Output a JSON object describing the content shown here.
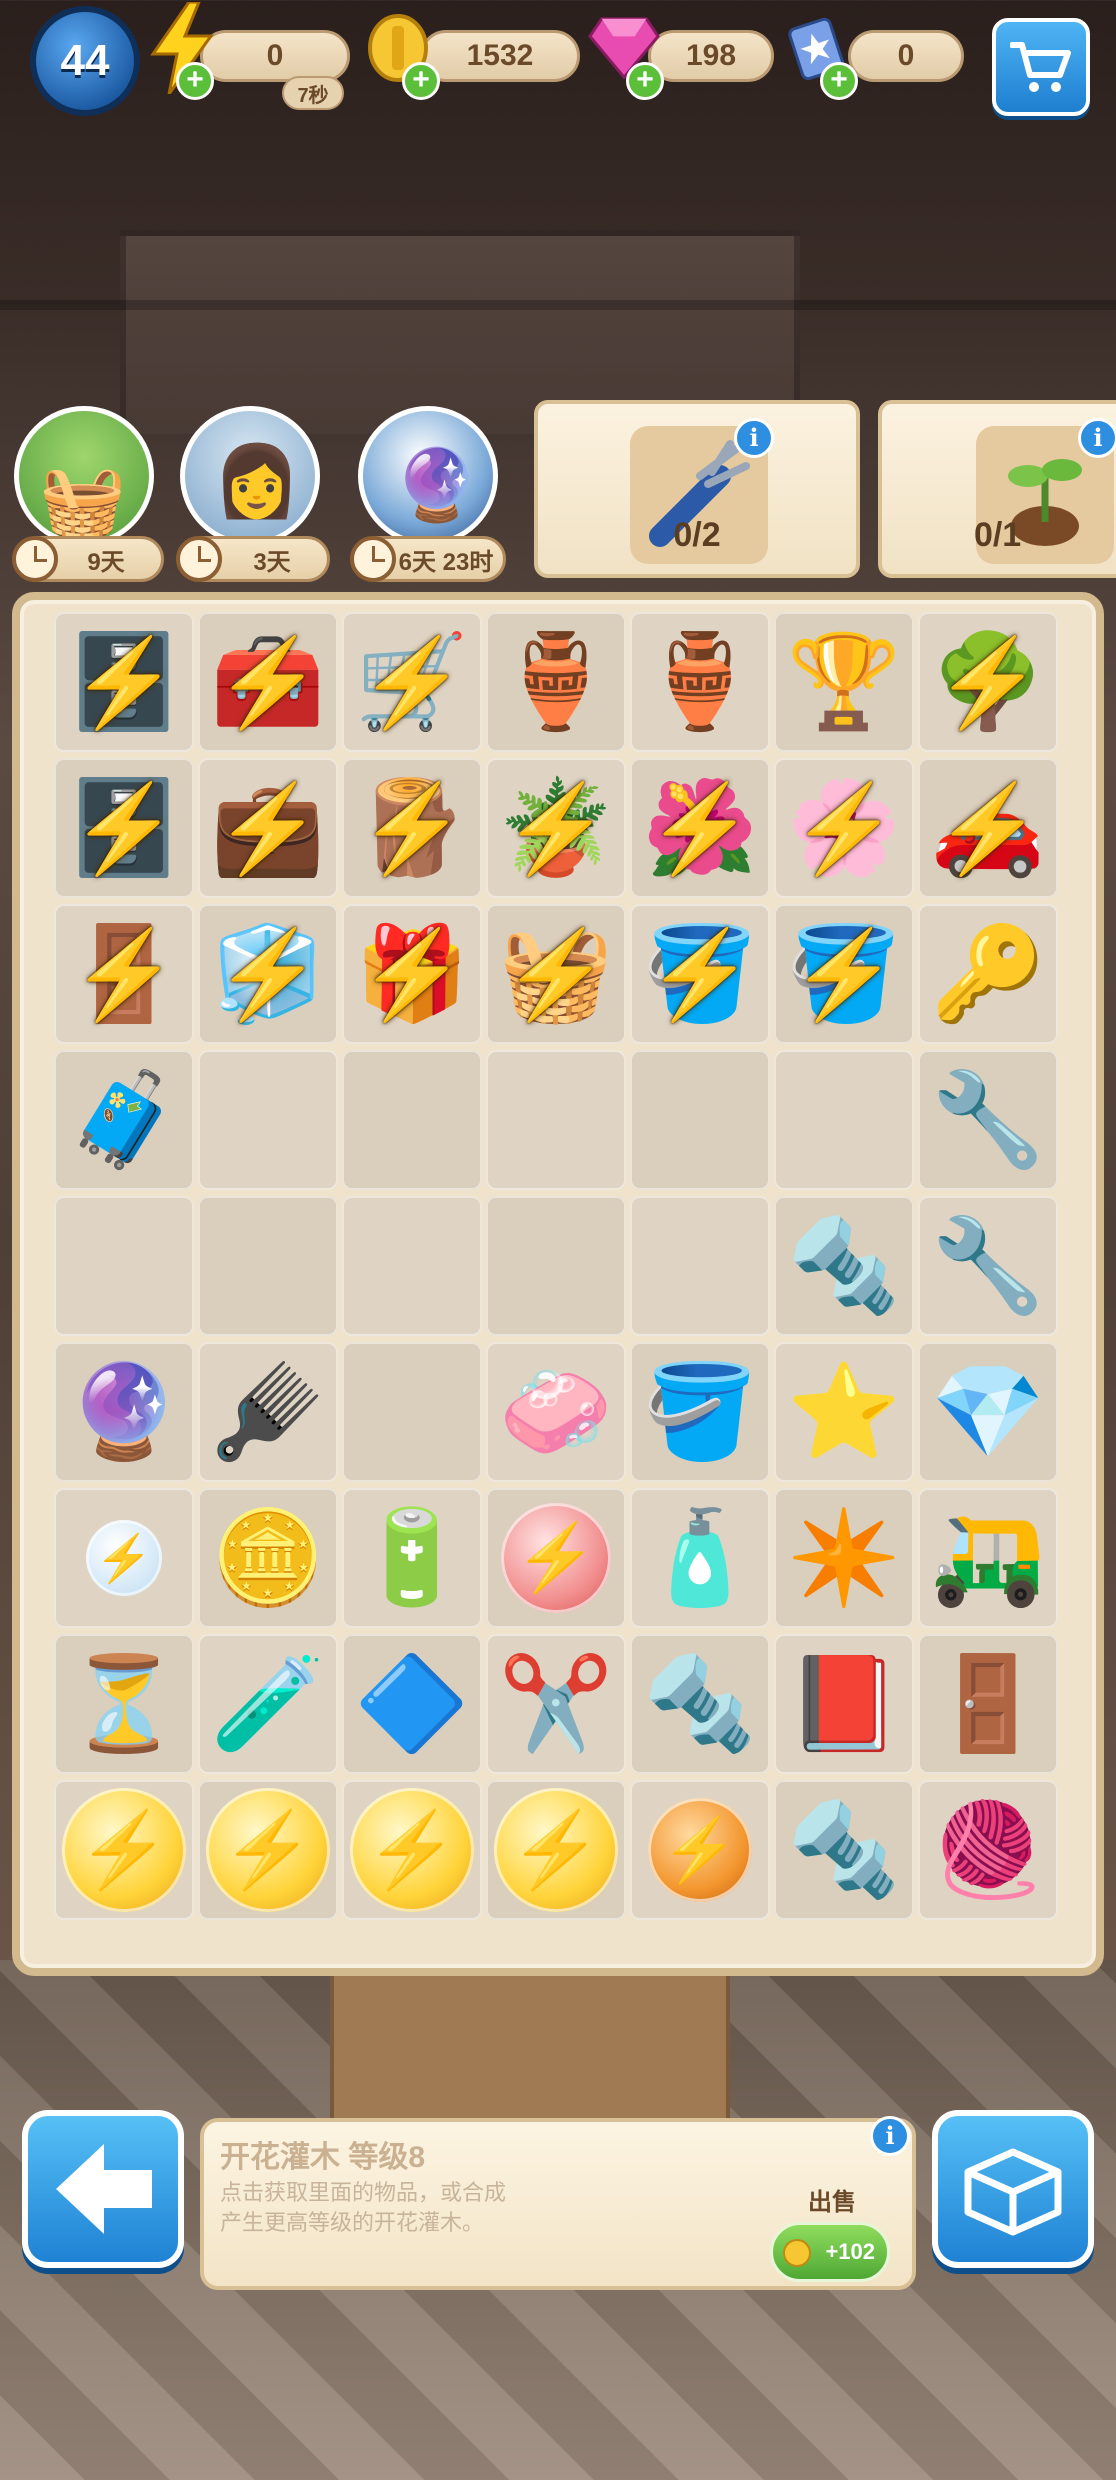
{
  "top_bar": {
    "level": "44",
    "energy": {
      "value": "0",
      "timer": "7秒",
      "icon": "lightning-icon"
    },
    "coins": {
      "value": "1532",
      "icon": "coin-icon"
    },
    "gems": {
      "value": "198",
      "icon": "gem-icon"
    },
    "cards": {
      "value": "0",
      "icon": "card-icon"
    },
    "shop_icon": "cart-icon"
  },
  "characters": [
    {
      "name": "easter-eggs-basket",
      "timer": "9天"
    },
    {
      "name": "binoculars-girl",
      "timer": "3天"
    },
    {
      "name": "crystal-ball",
      "timer": "6天 23时"
    }
  ],
  "tasks": [
    {
      "item": "multitool-icon",
      "progress": "0/2"
    },
    {
      "item": "sprout-icon",
      "progress": "0/1"
    }
  ],
  "board": {
    "rows": [
      [
        {
          "emoji": "🗄️",
          "name": "dresser-fruit",
          "locked": true
        },
        {
          "emoji": "🧰",
          "name": "tool-chest-open",
          "locked": true
        },
        {
          "emoji": "🛒",
          "name": "tool-cart",
          "locked": true
        },
        {
          "emoji": "🏺",
          "name": "porcelain-vase",
          "locked": false
        },
        {
          "emoji": "🏺",
          "name": "porcelain-vase",
          "locked": false
        },
        {
          "emoji": "🏆",
          "name": "glass-vase",
          "locked": false
        },
        {
          "emoji": "🌳",
          "name": "tree",
          "locked": true
        }
      ],
      [
        {
          "emoji": "🗄️",
          "name": "dresser-fruit",
          "locked": true
        },
        {
          "emoji": "💼",
          "name": "briefcase-tools",
          "locked": true
        },
        {
          "emoji": "🪵",
          "name": "wooden-cart",
          "locked": true
        },
        {
          "emoji": "🪴",
          "name": "potted-plant",
          "locked": true
        },
        {
          "emoji": "🌺",
          "name": "flowering-shrub",
          "locked": true
        },
        {
          "emoji": "🌸",
          "name": "flower-box",
          "locked": true
        },
        {
          "emoji": "🚗",
          "name": "toy-car",
          "locked": true
        }
      ],
      [
        {
          "emoji": "🚪",
          "name": "cabinet",
          "locked": true
        },
        {
          "emoji": "🧊",
          "name": "locker",
          "locked": true
        },
        {
          "emoji": "🎁",
          "name": "jewelry-box",
          "locked": true
        },
        {
          "emoji": "🧺",
          "name": "basket",
          "locked": true
        },
        {
          "emoji": "🪣",
          "name": "garden-trolley",
          "locked": true
        },
        {
          "emoji": "🪣",
          "name": "barrel-tools",
          "locked": true
        },
        {
          "emoji": "🔑",
          "name": "keys",
          "locked": false
        }
      ],
      [
        {
          "emoji": "🧳",
          "name": "toolbox-orange",
          "locked": false
        },
        {
          "emoji": "",
          "name": "empty",
          "locked": false
        },
        {
          "emoji": "",
          "name": "empty",
          "locked": false
        },
        {
          "emoji": "",
          "name": "empty",
          "locked": false
        },
        {
          "emoji": "",
          "name": "empty",
          "locked": false
        },
        {
          "emoji": "",
          "name": "empty",
          "locked": false
        },
        {
          "emoji": "🔧",
          "name": "screwdriver-set",
          "locked": false
        }
      ],
      [
        {
          "emoji": "",
          "name": "empty",
          "locked": false
        },
        {
          "emoji": "",
          "name": "empty",
          "locked": false
        },
        {
          "emoji": "",
          "name": "empty",
          "locked": false
        },
        {
          "emoji": "",
          "name": "empty",
          "locked": false
        },
        {
          "emoji": "",
          "name": "empty",
          "locked": false
        },
        {
          "emoji": "🔩",
          "name": "bolts",
          "locked": false
        },
        {
          "emoji": "🔧",
          "name": "wrench-set",
          "locked": false
        }
      ],
      [
        {
          "emoji": "🔮",
          "name": "crystal-ball",
          "locked": false
        },
        {
          "emoji": "🪮",
          "name": "brush",
          "locked": false
        },
        {
          "emoji": "",
          "name": "empty",
          "locked": false
        },
        {
          "emoji": "🧼",
          "name": "soap",
          "locked": false
        },
        {
          "emoji": "🪣",
          "name": "pink-bucket",
          "locked": false
        },
        {
          "emoji": "⭐",
          "name": "blue-star-small",
          "locked": false
        },
        {
          "emoji": "💎",
          "name": "pink-gems",
          "locked": false
        }
      ],
      [
        {
          "emoji": "⚡",
          "name": "energy-bubble-small",
          "locked": false
        },
        {
          "emoji": "🪙",
          "name": "coin-pile",
          "locked": false
        },
        {
          "emoji": "🔋",
          "name": "batteries",
          "locked": false
        },
        {
          "emoji": "⚡",
          "name": "energy-bubble-red",
          "locked": false
        },
        {
          "emoji": "🧴",
          "name": "soap-bottle",
          "locked": false
        },
        {
          "emoji": "✴️",
          "name": "blue-star-big",
          "locked": false
        },
        {
          "emoji": "🛺",
          "name": "hand-truck",
          "locked": false
        }
      ],
      [
        {
          "emoji": "⏳",
          "name": "hourglass",
          "locked": false
        },
        {
          "emoji": "🧪",
          "name": "glue-tube",
          "locked": false
        },
        {
          "emoji": "🔷",
          "name": "blue-star-gem",
          "locked": false
        },
        {
          "emoji": "✂️",
          "name": "pliers",
          "locked": false
        },
        {
          "emoji": "🔩",
          "name": "screws-springs",
          "locked": false
        },
        {
          "emoji": "📕",
          "name": "book-box",
          "locked": false
        },
        {
          "emoji": "🚪",
          "name": "door-package",
          "locked": false
        }
      ],
      [
        {
          "emoji": "⚡",
          "name": "energy-bubble",
          "locked": false
        },
        {
          "emoji": "⚡",
          "name": "energy-bubble",
          "locked": false
        },
        {
          "emoji": "⚡",
          "name": "energy-bubble",
          "locked": false
        },
        {
          "emoji": "⚡",
          "name": "energy-bubble",
          "locked": false
        },
        {
          "emoji": "⚡",
          "name": "energy-bubble-orange",
          "locked": false
        },
        {
          "emoji": "🔩",
          "name": "screws-pile",
          "locked": false
        },
        {
          "emoji": "🧶",
          "name": "cables",
          "locked": false
        }
      ]
    ]
  },
  "detail_panel": {
    "title": "开花灌木 等级8",
    "description": "点击获取里面的物品，或合成产生更高等级的开花灌木。",
    "sell_label": "出售",
    "sell_price": "+102"
  },
  "colors": {
    "accent_blue": "#2e8ee0",
    "plus_green": "#5cbf3a",
    "board_bg": "#efe3cc",
    "bolt_yellow": "#ffe14a"
  }
}
